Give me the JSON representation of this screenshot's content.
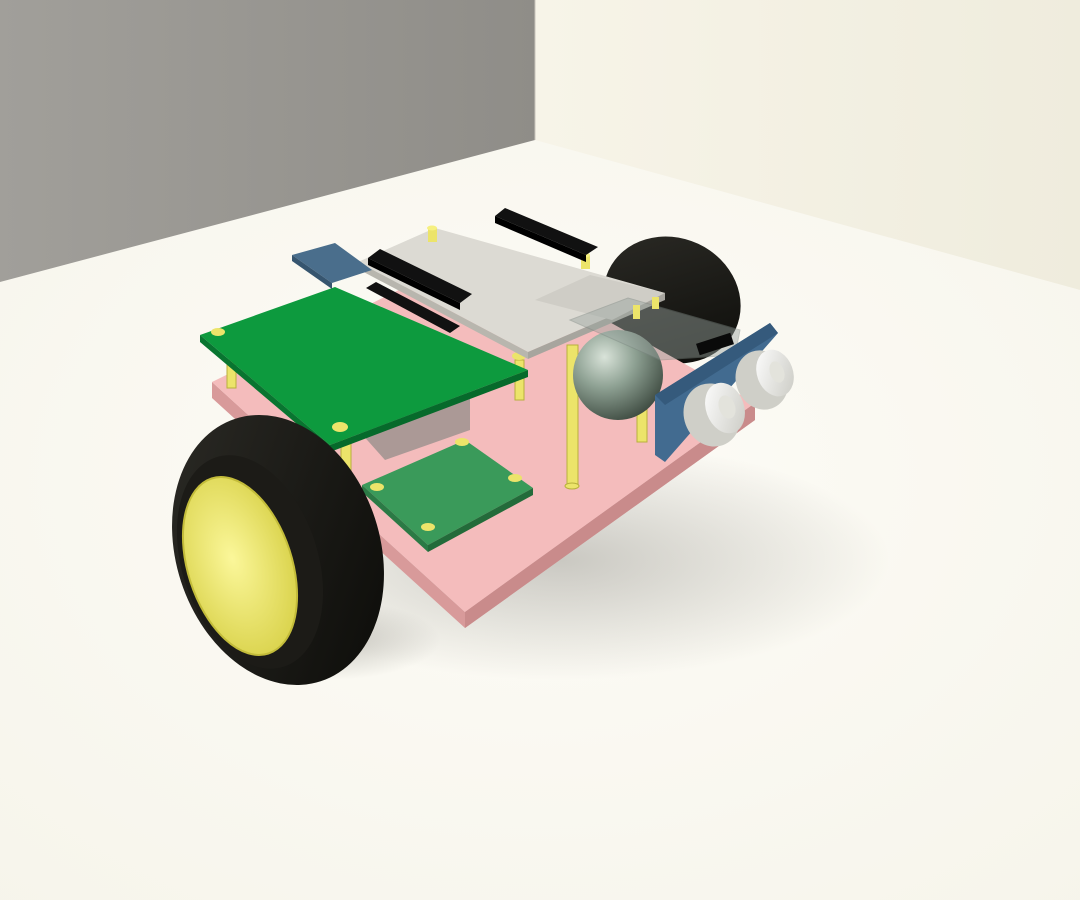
{
  "scene": {
    "subject": "robot-car-model",
    "colors": {
      "wall_left": "#9c9a95",
      "wall_right": "#f4f1e4",
      "floor": "#fbfaf4",
      "chassis_top": "#f4bcbc",
      "chassis_edge": "#d89a9a",
      "green_board": "#0d9a3e",
      "green_board_edge": "#087530",
      "small_board": "#3a9a5a",
      "white_board": "#dcdad3",
      "header_black": "#111111",
      "usb_blue": "#4a6e8c",
      "standoff_brass": "#ece46a",
      "tire": "#141410",
      "hub_yellow": "#f2ec6c",
      "caster_ball": "#8fa294",
      "sonar_board": "#426b90",
      "sonar_transducer": "#eeeeea"
    },
    "parts": [
      "base-chassis",
      "rear-wheel-left",
      "rear-wheel-right",
      "green-main-board",
      "white-controller-board",
      "pin-headers",
      "usb-connector",
      "small-green-board",
      "caster-ball",
      "ultrasonic-sensor",
      "brass-standoffs"
    ]
  }
}
